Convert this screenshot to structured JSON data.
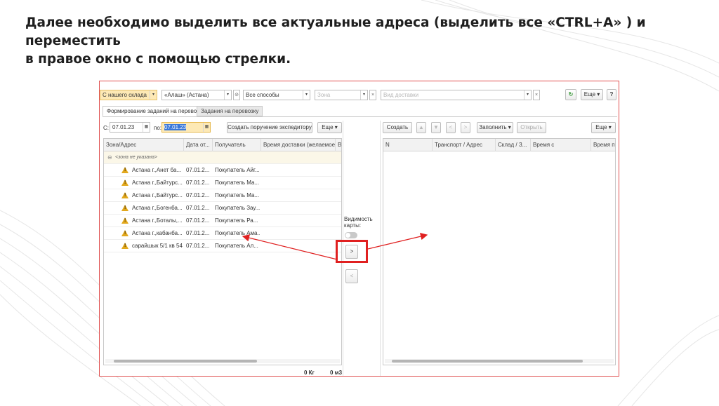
{
  "headline": {
    "line1": "Далее необходимо выделить все актуальные адреса (выделить все  «CTRL+A» ) и переместить",
    "line2": "в правое окно с помощью стрелки."
  },
  "filters": {
    "warehouse": "С нашего склада",
    "company": "«Алаш» (Астана)",
    "method": "Все способы",
    "zone_placeholder": "Зона",
    "delivery_placeholder": "Вид доставки",
    "more_label": "Еще",
    "help_label": "?"
  },
  "tabs": [
    {
      "label": "Формирование заданий на перевозку",
      "active": true
    },
    {
      "label": "Задания на перевозку",
      "active": false
    }
  ],
  "left_toolbar": {
    "from_label": "С:",
    "from_date": "07.01.23",
    "to_label": "по:",
    "to_date": "07.01.23",
    "create_button": "Создать поручение экспедитору",
    "more_label": "Еще"
  },
  "left_table": {
    "columns": [
      "Зона/Адрес",
      "Дата от...",
      "Получатель",
      "Время доставки (желаемое)",
      "Во"
    ],
    "group_label": "<зона не указана>",
    "rows": [
      {
        "address": "Астана г.,Анет ба...",
        "date": "07.01.2...",
        "recipient": "Покупатель Aйг..."
      },
      {
        "address": "Астана г.,Байтурс...",
        "date": "07.01.2...",
        "recipient": "Покупатель Ма..."
      },
      {
        "address": "Астана г.,Байтурс...",
        "date": "07.01.2...",
        "recipient": "Покупатель Ма..."
      },
      {
        "address": "Астана г.,Богенба...",
        "date": "07.01.2...",
        "recipient": "Покупатель Зау..."
      },
      {
        "address": "Астана г.,Боталы,...",
        "date": "07.01.2...",
        "recipient": "Покупатель Ра..."
      },
      {
        "address": "Астана г.,кабанба...",
        "date": "07.01.2...",
        "recipient": "Покупатель Ама..."
      },
      {
        "address": "сарайшык 5/1 кв 544",
        "date": "07.01.2...",
        "recipient": "Покупатель Ал..."
      }
    ],
    "footer_weight": "0 Кг",
    "footer_volume": "0 м3"
  },
  "middle": {
    "map_visibility_label_1": "Видимость",
    "map_visibility_label_2": "карты:",
    "move_right_label": ">",
    "move_left_label": "<"
  },
  "right_toolbar": {
    "create_button": "Создать",
    "fill_button": "Заполнить",
    "open_button": "Открыть",
    "more_label": "Еще"
  },
  "right_table": {
    "columns": [
      "N",
      "Транспорт / Адрес",
      "Склад / З...",
      "Время с",
      "Время по"
    ]
  },
  "colors": {
    "annotation_red": "#e02020",
    "highlight_field": "#fde9b5",
    "warning_icon": "#e2a81c"
  }
}
